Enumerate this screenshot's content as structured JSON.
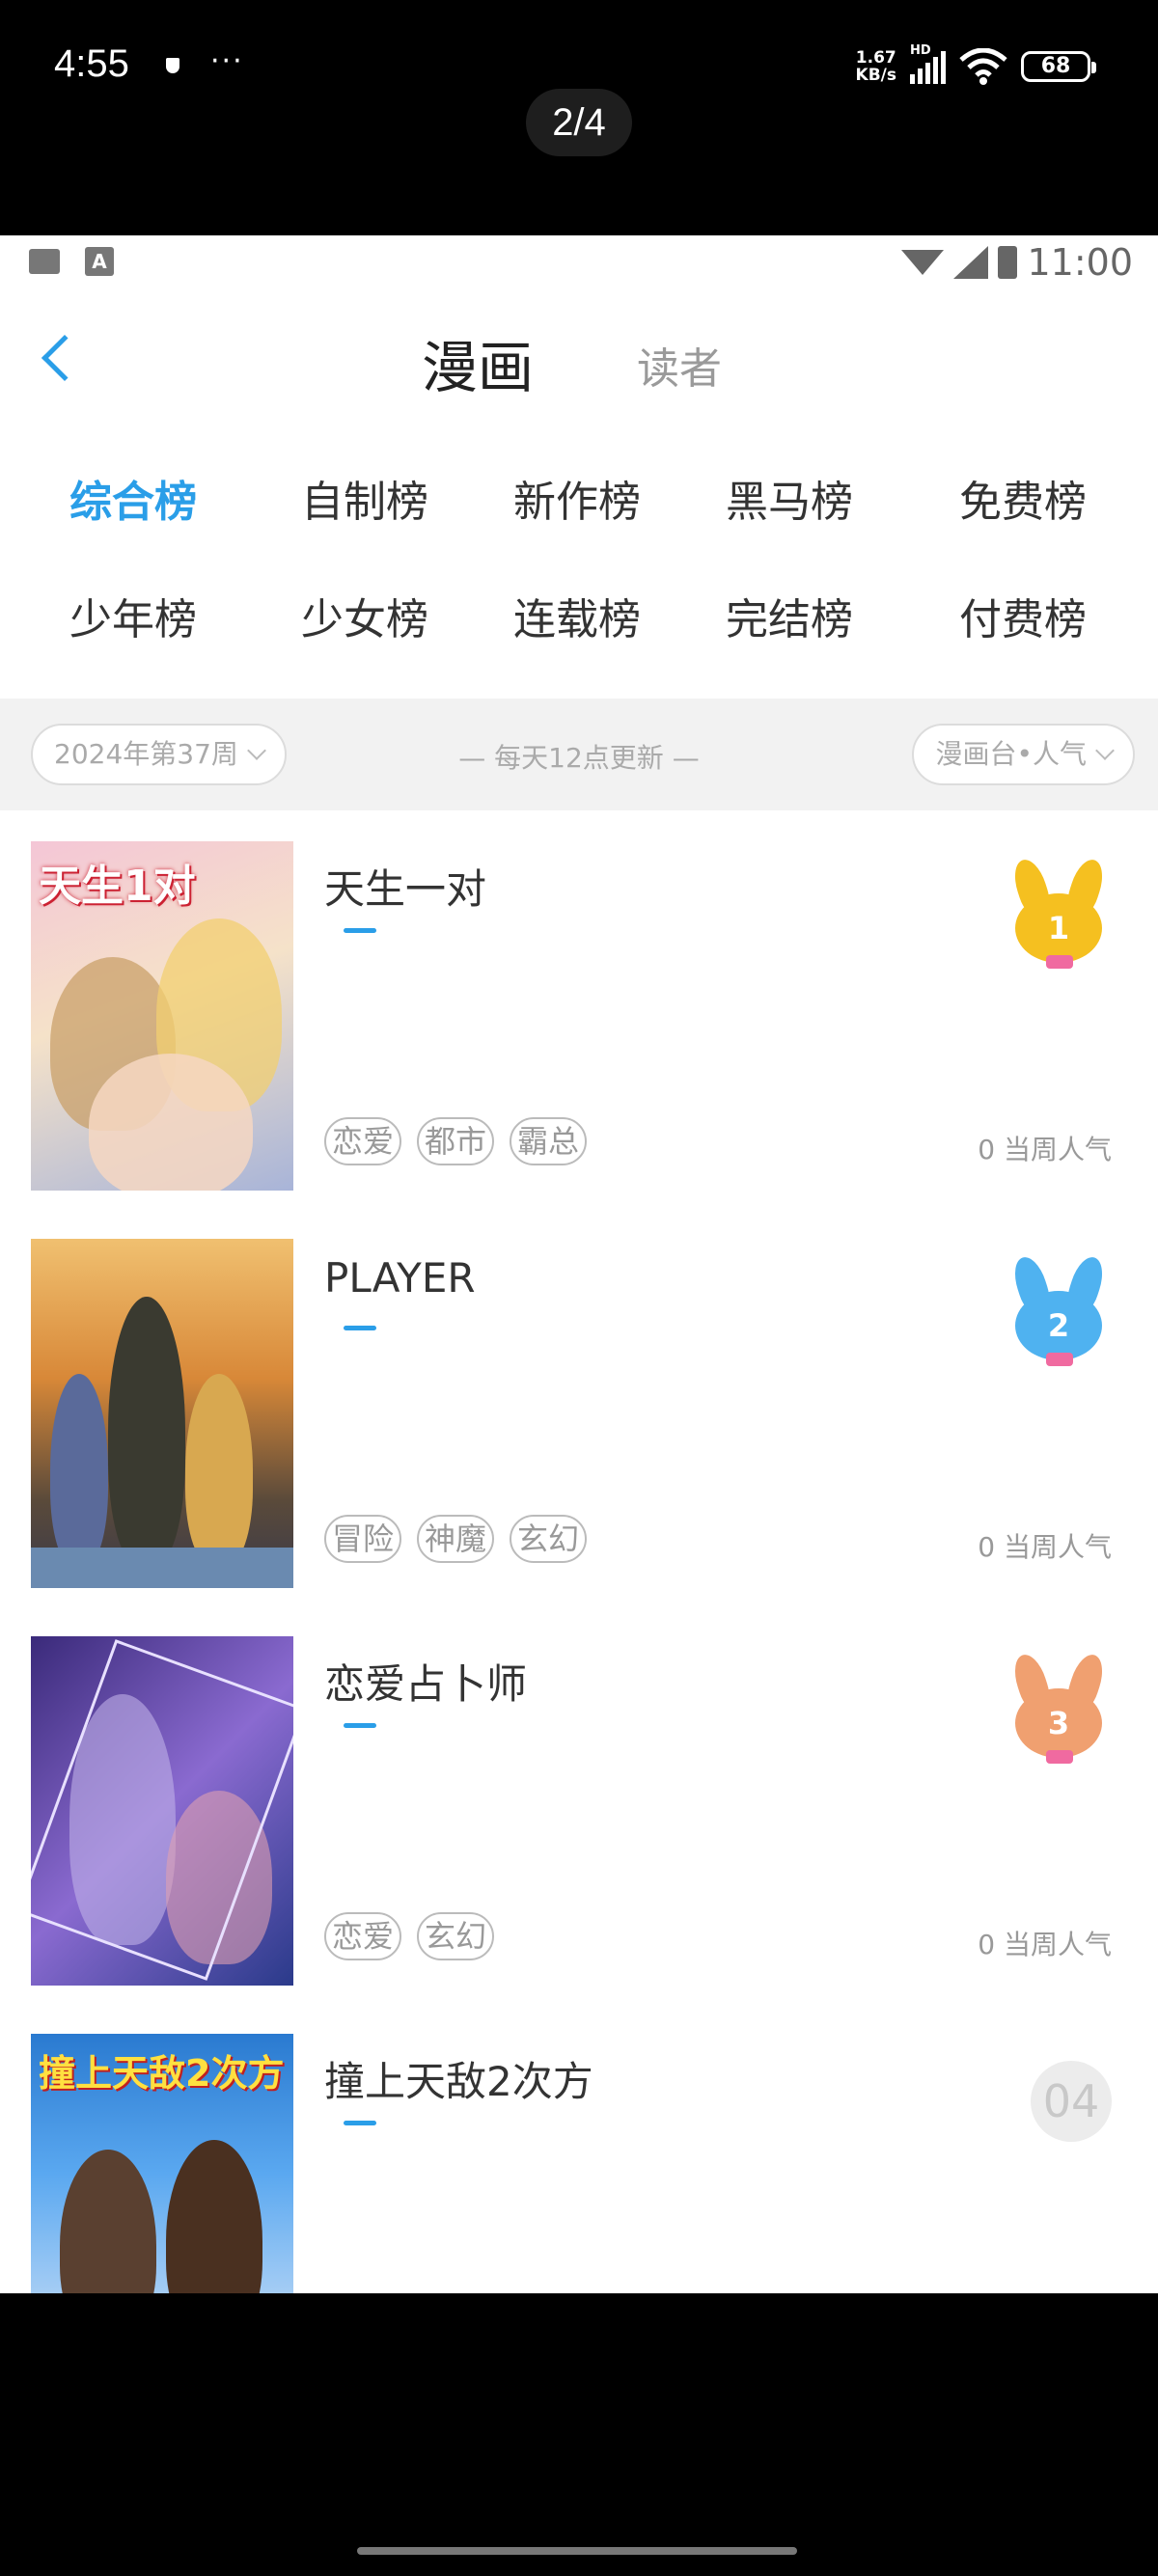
{
  "phone_status": {
    "time": "4:55",
    "dots": "···",
    "net_speed_top": "1.67",
    "net_speed_bottom": "KB/s",
    "hd": "HD",
    "battery": "68"
  },
  "page_indicator": "2/4",
  "inner_status": {
    "time": "11:00",
    "a_icon": "A"
  },
  "header": {
    "tab_active": "漫画",
    "tab_inactive": "读者"
  },
  "categories": [
    "综合榜",
    "自制榜",
    "新作榜",
    "黑马榜",
    "免费榜",
    "少年榜",
    "少女榜",
    "连载榜",
    "完结榜",
    "付费榜"
  ],
  "filter": {
    "week": "2024年第37周",
    "note": "— 每天12点更新 —",
    "sort": "漫画台•人气"
  },
  "items": [
    {
      "title": "天生一对",
      "tags": [
        "恋爱",
        "都市",
        "霸总"
      ],
      "popularity": "0 当周人气",
      "rank": "1",
      "cover_text": "天生1对"
    },
    {
      "title": "PLAYER",
      "tags": [
        "冒险",
        "神魔",
        "玄幻"
      ],
      "popularity": "0 当周人气",
      "rank": "2",
      "cover_text": ""
    },
    {
      "title": "恋爱占卜师",
      "tags": [
        "恋爱",
        "玄幻"
      ],
      "popularity": "0 当周人气",
      "rank": "3",
      "cover_text": ""
    },
    {
      "title": "撞上天敌2次方",
      "tags": [],
      "popularity": "",
      "rank": "04",
      "cover_text": "撞上天敌2次方"
    }
  ],
  "colors": {
    "accent": "#2a9ee8",
    "gold": "#f5c020",
    "blue": "#4fb2f0",
    "bronze": "#f0a070"
  }
}
